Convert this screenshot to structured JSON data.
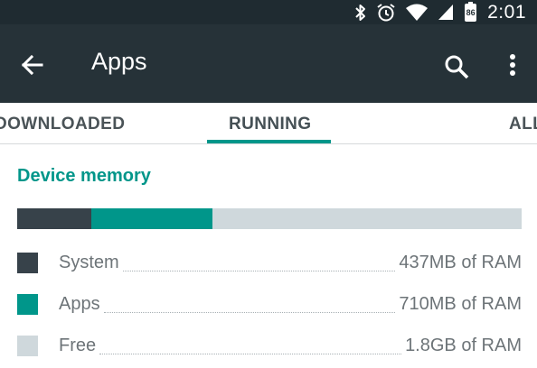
{
  "status_bar": {
    "time": "2:01",
    "battery": "86",
    "icons": [
      "bluetooth-icon",
      "alarm-icon",
      "wifi-icon",
      "cell-signal-icon",
      "battery-icon"
    ]
  },
  "app_bar": {
    "title": "Apps",
    "back_icon": "arrow-back-icon",
    "search_icon": "search-icon",
    "more_icon": "more-vert-icon"
  },
  "tabs": [
    {
      "label": "DOWNLOADED",
      "selected": false
    },
    {
      "label": "RUNNING",
      "selected": true
    },
    {
      "label": "ALL",
      "selected": false
    }
  ],
  "section": {
    "title": "Device memory"
  },
  "memory_bar": [
    {
      "name": "System",
      "fraction": 0.147,
      "color": "#37424a"
    },
    {
      "name": "Apps",
      "fraction": 0.24,
      "color": "#00968a"
    },
    {
      "name": "Free",
      "fraction": 0.613,
      "color": "#cfd8dc"
    }
  ],
  "legend": [
    {
      "label": "System",
      "value": "437MB of RAM",
      "color": "#37424a"
    },
    {
      "label": "Apps",
      "value": "710MB of RAM",
      "color": "#00968a"
    },
    {
      "label": "Free",
      "value": "1.8GB of RAM",
      "color": "#cfd8dc"
    }
  ],
  "colors": {
    "status_bar": "#1f2b31",
    "app_bar": "#263238",
    "accent": "#00968a"
  }
}
